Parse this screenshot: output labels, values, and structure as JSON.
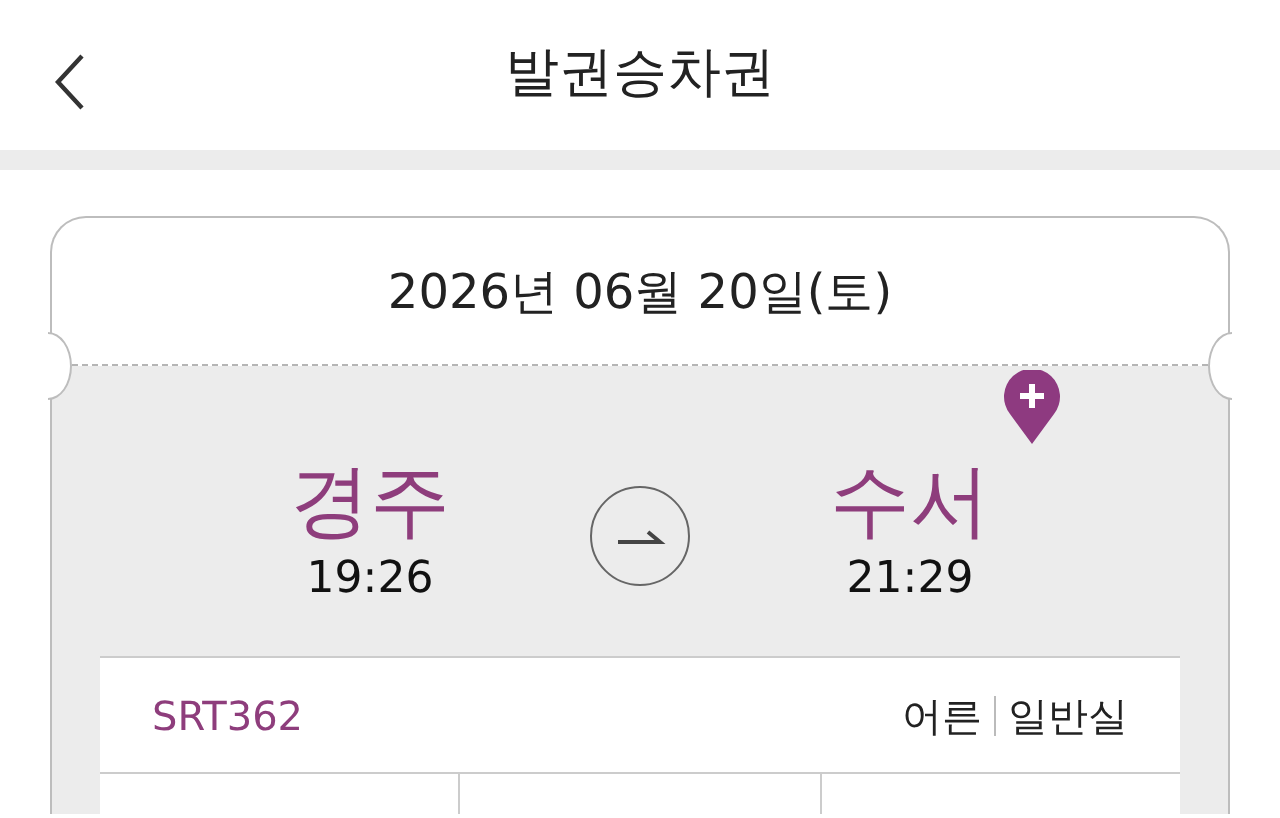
{
  "header": {
    "title": "발권승차권"
  },
  "ticket": {
    "date": "2026년 06월 20일(토)",
    "departure": {
      "station": "경주",
      "time": "19:26"
    },
    "arrival": {
      "station": "수서",
      "time": "21:29"
    },
    "train": "SRT362",
    "passenger": "어른",
    "seat_class": "일반실"
  }
}
